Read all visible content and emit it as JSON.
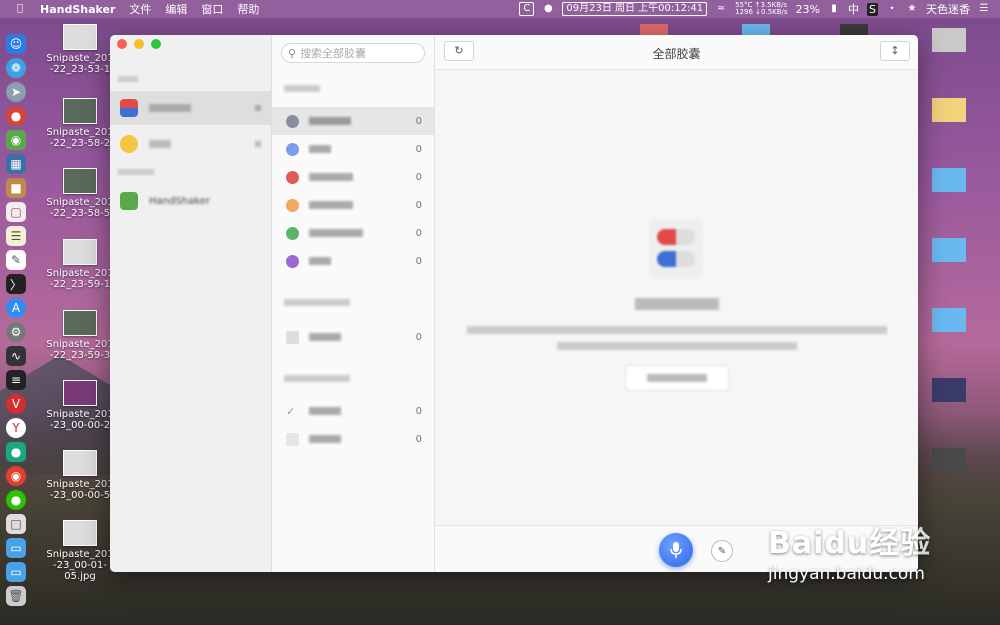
{
  "menubar": {
    "app_name": "HandShaker",
    "menus": [
      "文件",
      "编辑",
      "窗口",
      "帮助"
    ],
    "clock": "09月23日 周日 上午00:12:41",
    "net_temp": "55°C",
    "net_up": "↑3.5KB/s",
    "net_rpm": "1296",
    "net_down": "↓0.5KB/s",
    "battery": "23%",
    "input_method": "中",
    "user_name": "天色迷香"
  },
  "desktop_files": [
    {
      "name": "Snipaste_201",
      "sub": "-22_23-53-1"
    },
    {
      "name": "Snipaste_201",
      "sub": "-22_23-58-2"
    },
    {
      "name": "Snipaste_201",
      "sub": "-22_23-58-5"
    },
    {
      "name": "Snipaste_201",
      "sub": "-22_23-59-1"
    },
    {
      "name": "Snipaste_201",
      "sub": "-22_23-59-3"
    },
    {
      "name": "Snipaste_201",
      "sub": "-23_00-00-2"
    },
    {
      "name": "Snipaste_201",
      "sub": "-23_00-00-5"
    },
    {
      "name": "Snipaste_201",
      "sub": "-23_00-01-05.jpg"
    }
  ],
  "window": {
    "search_placeholder": "搜索全部胶囊",
    "title": "全部胶囊",
    "mid_counts": [
      "0",
      "0",
      "0",
      "0",
      "0",
      "0",
      "0",
      "0",
      "0"
    ],
    "sidebar_device": "HandShaker"
  },
  "watermark": {
    "brand": "Baidu经验",
    "url": "jingyan.baidu.com"
  }
}
